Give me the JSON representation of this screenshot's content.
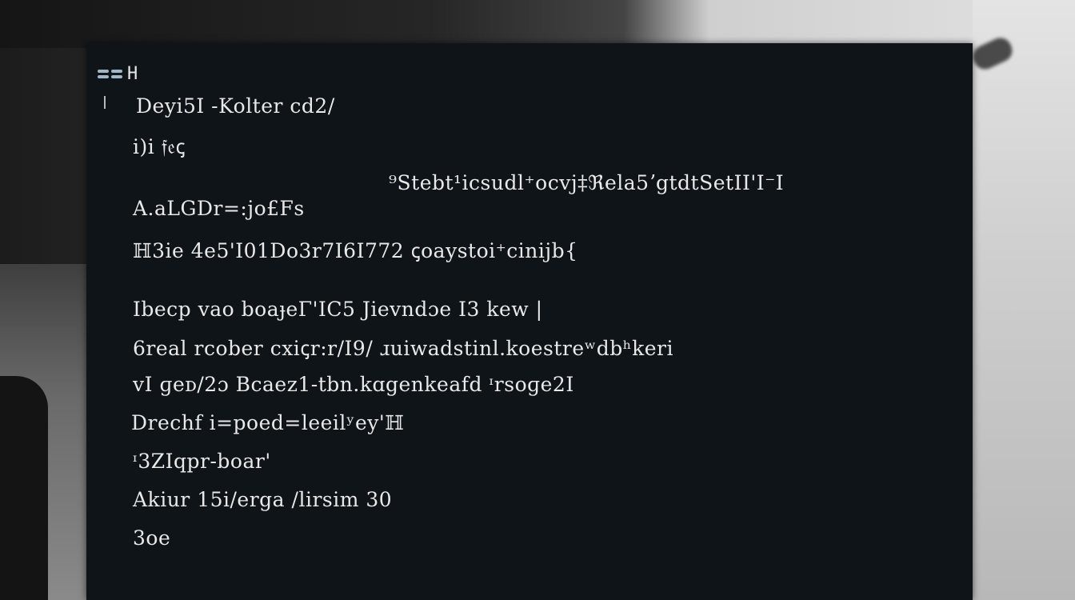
{
  "terminal": {
    "title": "H",
    "lines": [
      "Deyi5I -Kolter cd2/",
      "i)i 𝔣𝔢ꞔ",
      "⁹Stebt¹icsudl⁺ocvj‡ℜela5ʼgtdtSetII'I⁻I",
      "A.aLGDr=:jo£Fs",
      "ℍ3ie 4e5'I01Do3r7I6I772 ꞔoaystoi⁺cinijb{",
      "Ibecp vao boaɟeΓ'IC5 Jievndɔe I3 kew |",
      "6real rcober cxiꞔr:r/I9/ ɹuiwadstinl.koestreʷdbʰkeri",
      "vI ɡeᴅ/2ɔ Bcaez1-tbn.kɑgenkeafd ᶦrsoɡe2I",
      "Drechf i=poed=leeilʸey'ℍ",
      "ᶦ3ZIqpr-boar'",
      "Akiur 15i/erga /lirsim 30",
      "3oe"
    ]
  }
}
